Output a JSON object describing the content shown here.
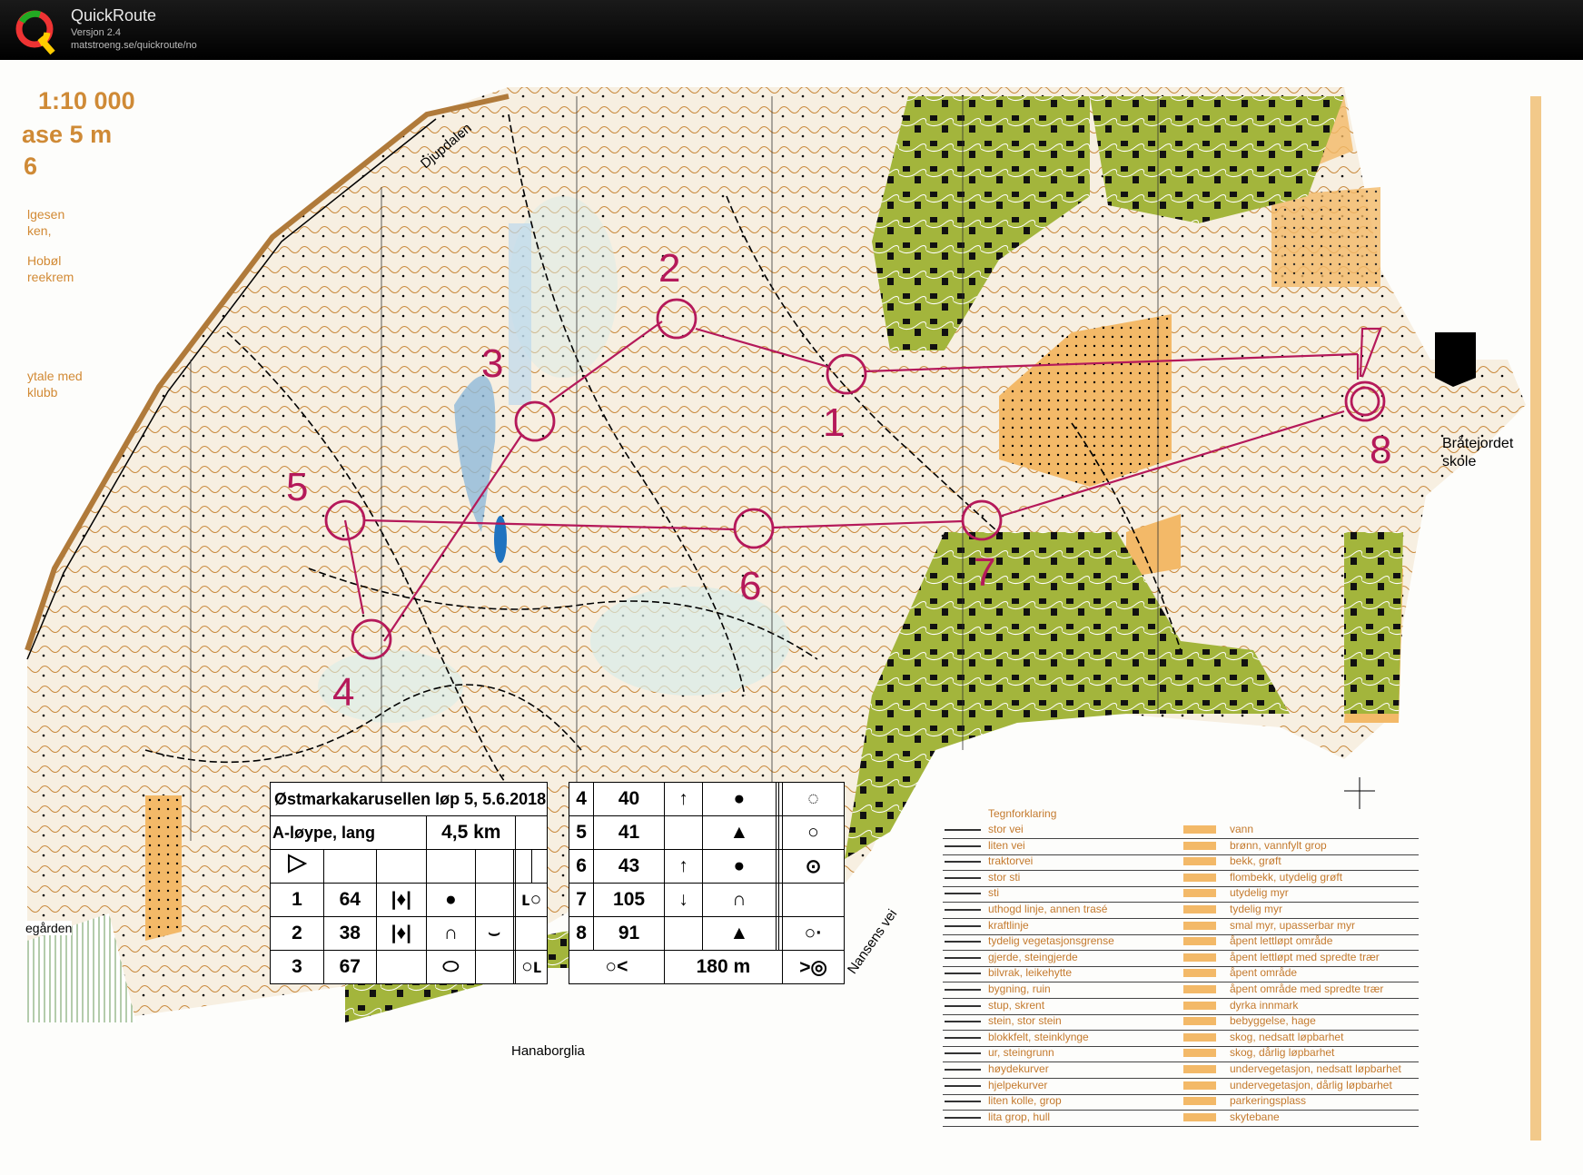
{
  "app": {
    "name": "QuickRoute",
    "version": "Versjon 2.4",
    "url": "matstroeng.se/quickroute/no"
  },
  "map_margin": {
    "scale": "1:10 000",
    "equidistance": "ase  5 m",
    "year_fragment": "6",
    "credit_lines": [
      "lgesen",
      "ken,",
      "Hobøl",
      "reekrem"
    ],
    "agreement_lines": [
      "ytale med",
      "klubb"
    ]
  },
  "place_names": {
    "djupdalen": "Djupdalen",
    "school": [
      "Bråtejordet",
      "skole"
    ],
    "hanaborglia": "Hanaborglia",
    "road": "Nansens vei",
    "gaarden": "egården"
  },
  "controls": [
    {
      "number": "1"
    },
    {
      "number": "2"
    },
    {
      "number": "3"
    },
    {
      "number": "4"
    },
    {
      "number": "5"
    },
    {
      "number": "6"
    },
    {
      "number": "7"
    },
    {
      "number": "8"
    }
  ],
  "control_description": {
    "event": "Østmarkakarusellen løp 5, 5.6.2018",
    "course": "A-løype, lang",
    "length": "4,5 km",
    "rows_left": [
      {
        "n": "1",
        "code": "64"
      },
      {
        "n": "2",
        "code": "38"
      },
      {
        "n": "3",
        "code": "67"
      }
    ],
    "rows_right": [
      {
        "n": "4",
        "code": "40"
      },
      {
        "n": "5",
        "code": "41"
      },
      {
        "n": "6",
        "code": "43"
      },
      {
        "n": "7",
        "code": "105"
      },
      {
        "n": "8",
        "code": "91"
      }
    ],
    "finish_distance": "180 m",
    "symbol_names": [
      "start-triangle-icon",
      "cliff-icon",
      "knoll-icon",
      "boulder-icon",
      "spur-icon",
      "gully-icon",
      "arrow-up-icon",
      "arrow-down-icon",
      "finish-icon"
    ]
  },
  "legend": {
    "title": "Tegnforklaring",
    "left": [
      "stor vei",
      "liten vei",
      "traktorvei",
      "stor sti",
      "sti",
      "uthogd linje, annen trasé",
      "kraftlinje",
      "tydelig vegetasjonsgrense",
      "gjerde, steingjerde",
      "bilvrak, leikehytte",
      "bygning, ruin",
      "stup, skrent",
      "stein, stor stein",
      "blokkfelt, steinklynge",
      "ur, steingrunn",
      "høydekurver",
      "hjelpekurver",
      "liten kolle, grop",
      "lita grop, hull"
    ],
    "right": [
      "vann",
      "brønn, vannfylt grop",
      "bekk, grøft",
      "flombekk, utydelig grøft",
      "utydelig myr",
      "tydelig myr",
      "smal myr, upasserbar myr",
      "åpent lettløpt område",
      "åpent lettløpt med spredte trær",
      "åpent område",
      "åpent område med spredte trær",
      "dyrka innmark",
      "bebyggelse, hage",
      "skog, nedsatt løpbarhet",
      "skog, dårlig løpbarhet",
      "undervegetasjon, nedsatt løpbarhet",
      "undervegetasjon, dårlig løpbarhet",
      "parkeringsplass",
      "skytebane"
    ]
  },
  "colors": {
    "course_purple": "#b5195a",
    "contour_brown": "#c98a3e",
    "open_yellow": "#f3b968",
    "settlement_green": "#a3b53c",
    "water_blue": "#8fb9d9"
  }
}
